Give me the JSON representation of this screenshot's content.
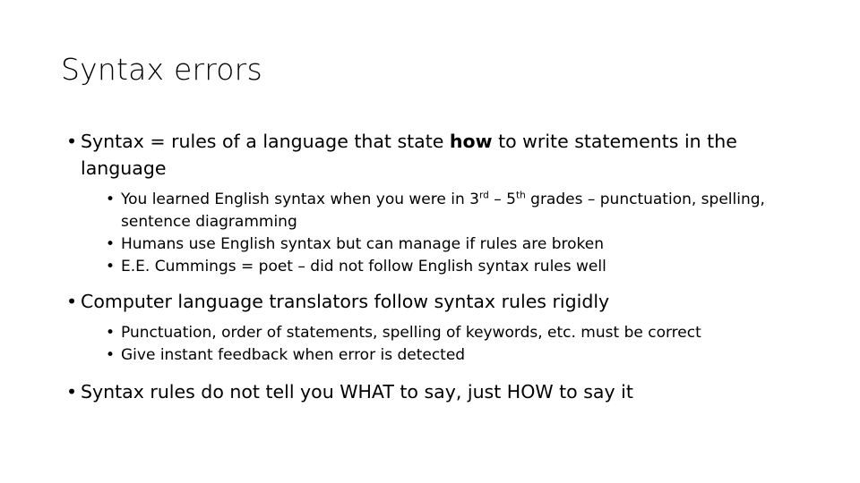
{
  "slide": {
    "title": "Syntax errors",
    "bullet_marker": "•",
    "text_color": "#000000",
    "background_color": "#ffffff",
    "blocks": [
      {
        "level": 1,
        "id": "syntax-definition",
        "text_parts": [
          {
            "text": "Syntax = rules of a language that state ",
            "bold": false
          },
          {
            "text": "how",
            "bold": true
          },
          {
            "text": " to write statements in the language",
            "bold": false
          }
        ],
        "plain_text": "Syntax = rules of a language that state how to write statements in the language"
      },
      {
        "level": 2,
        "id": "english-syntax-grades",
        "plain_text": "You learned English syntax when you were in 3rd – 5th grades – punctuation, spelling, sentence diagramming",
        "segments": [
          {
            "text": "You learned English syntax when you were in 3",
            "sup": false
          },
          {
            "text": "rd",
            "sup": true
          },
          {
            "text": " – 5",
            "sup": false
          },
          {
            "text": "th",
            "sup": true
          },
          {
            "text": " grades – punctuation, spelling, sentence diagramming",
            "sup": false
          }
        ]
      },
      {
        "level": 2,
        "id": "humans-manage-broken-rules",
        "plain_text": "Humans use English syntax but can manage if rules are broken"
      },
      {
        "level": 2,
        "id": "ee-cummings",
        "plain_text": "E.E. Cummings = poet – did not follow English syntax rules well"
      },
      {
        "level": 1,
        "id": "translators-rigid",
        "plain_text": "Computer language translators follow syntax rules rigidly"
      },
      {
        "level": 2,
        "id": "punctuation-order-spelling",
        "plain_text": "Punctuation, order of statements, spelling of keywords, etc. must be correct"
      },
      {
        "level": 2,
        "id": "instant-feedback",
        "plain_text": "Give instant feedback when error is detected"
      },
      {
        "level": 1,
        "id": "what-vs-how",
        "plain_text": "Syntax rules do not tell you WHAT to say, just HOW to say it"
      }
    ]
  }
}
